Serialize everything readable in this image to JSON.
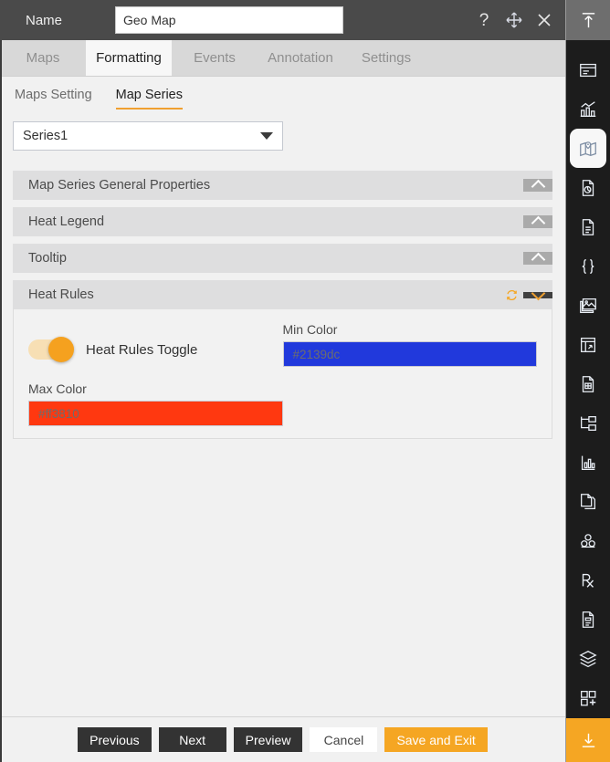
{
  "header": {
    "name_label": "Name",
    "name_value": "Geo Map",
    "name_placeholder": "Name",
    "help_icon": "question-mark-icon",
    "move_icon": "move-icon",
    "close_icon": "close-icon"
  },
  "tabs": [
    {
      "label": "Maps",
      "active": false
    },
    {
      "label": "Formatting",
      "active": true
    },
    {
      "label": "Events",
      "active": false
    },
    {
      "label": "Annotation",
      "active": false
    },
    {
      "label": "Settings",
      "active": false
    }
  ],
  "subtabs": [
    {
      "label": "Maps Setting",
      "active": false
    },
    {
      "label": "Map Series",
      "active": true
    }
  ],
  "series_select": {
    "value": "Series1",
    "options": [
      "Series1"
    ],
    "caret_icon": "chevron-down-icon"
  },
  "sections": [
    {
      "label": "Map Series General Properties",
      "expanded": false,
      "chevron_icon": "chevron-up-icon"
    },
    {
      "label": "Heat Legend",
      "expanded": false,
      "chevron_icon": "chevron-up-icon"
    },
    {
      "label": "Tooltip",
      "expanded": false,
      "chevron_icon": "chevron-up-icon"
    },
    {
      "label": "Heat Rules",
      "expanded": true,
      "chevron_icon": "chevron-down-icon",
      "refresh_icon": "refresh-icon"
    }
  ],
  "heat_rules": {
    "toggle_label": "Heat Rules Toggle",
    "toggle_on": true,
    "min_color_label": "Min Color",
    "min_color_value": "#2139dc",
    "max_color_label": "Max Color",
    "max_color_value": "#ff3810"
  },
  "footer_buttons": [
    {
      "label": "Previous",
      "style": "dark"
    },
    {
      "label": "Next",
      "style": "dark"
    },
    {
      "label": "Preview",
      "style": "dark"
    },
    {
      "label": "Cancel",
      "style": "light"
    },
    {
      "label": "Save and Exit",
      "style": "accent"
    }
  ],
  "rail": {
    "top_icon": "collapse-up-icon",
    "bottom_icon": "download-icon",
    "items": [
      {
        "icon": "window-panel-icon",
        "active": false
      },
      {
        "icon": "bar-chart-icon",
        "active": false
      },
      {
        "icon": "map-pin-icon",
        "active": true
      },
      {
        "icon": "report-pie-document-icon",
        "active": false
      },
      {
        "icon": "text-document-icon",
        "active": false
      },
      {
        "icon": "curly-braces-icon",
        "active": false
      },
      {
        "icon": "image-gallery-icon",
        "active": false
      },
      {
        "icon": "table-layout-icon",
        "active": false
      },
      {
        "icon": "page-grid-icon",
        "active": false
      },
      {
        "icon": "hierarchy-tree-icon",
        "active": false
      },
      {
        "icon": "chart-axis-icon",
        "active": false
      },
      {
        "icon": "copy-page-icon",
        "active": false
      },
      {
        "icon": "cubes-icon",
        "active": false
      },
      {
        "icon": "prescription-rx-icon",
        "active": false
      },
      {
        "icon": "form-document-icon",
        "active": false
      },
      {
        "icon": "layers-icon",
        "active": false
      },
      {
        "icon": "add-widget-icon",
        "active": false
      }
    ]
  },
  "theme": {
    "accent": "#f5a623",
    "titlebar_bg": "#4a4a4a",
    "rail_bg": "#1c1c1c",
    "section_bg": "#dededf"
  }
}
